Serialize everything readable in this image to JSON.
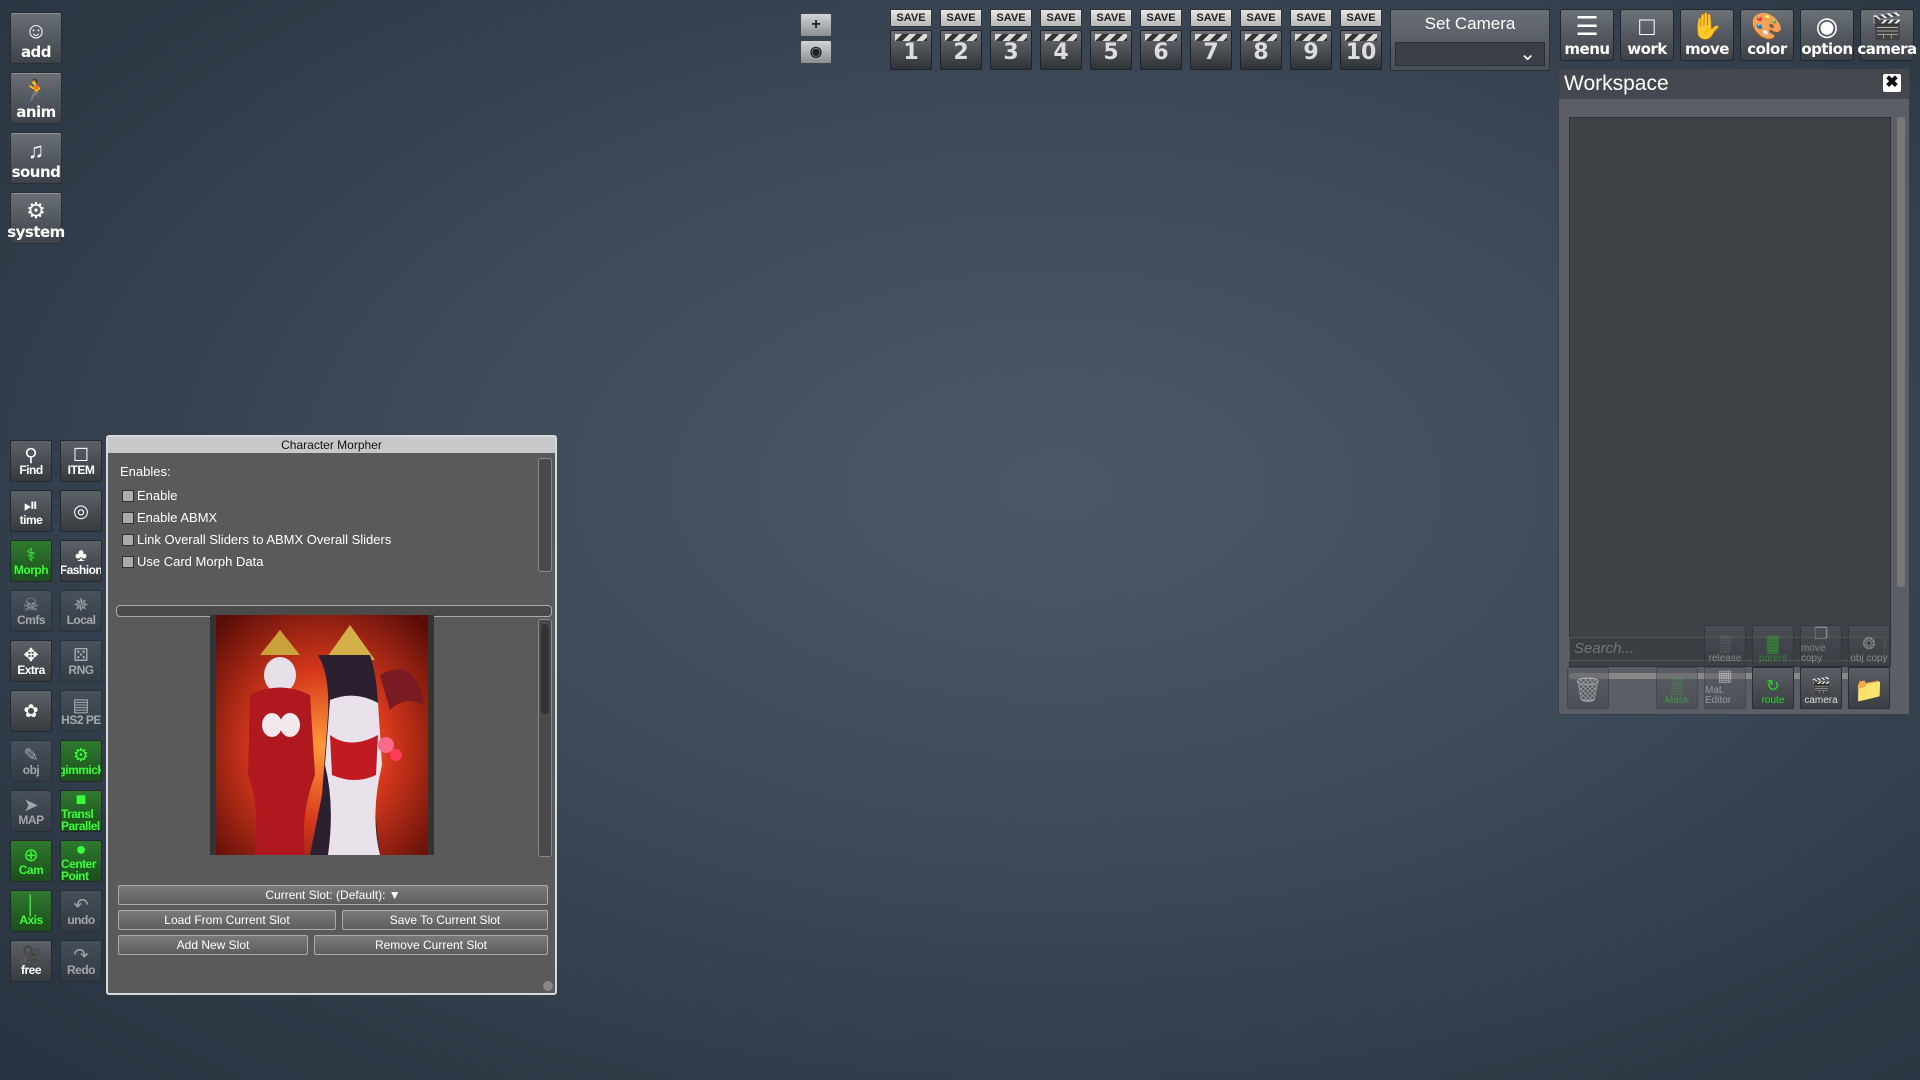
{
  "left_toolbar": {
    "buttons": [
      {
        "label": "add",
        "icon": "add-person-icon"
      },
      {
        "label": "anim",
        "icon": "running-person-icon"
      },
      {
        "label": "sound",
        "icon": "music-note-icon"
      },
      {
        "label": "system",
        "icon": "gears-icon"
      }
    ]
  },
  "tools": [
    {
      "label": "Find",
      "icon": "magnifier-icon",
      "green": false,
      "dim": false
    },
    {
      "label": "ITEM",
      "icon": "item-icon",
      "green": false,
      "dim": false
    },
    {
      "label": "time",
      "icon": "play-pause-icon",
      "green": false,
      "dim": false
    },
    {
      "label": "",
      "icon": "camera-shutter-icon",
      "green": false,
      "dim": false
    },
    {
      "label": "Morph",
      "icon": "morph-icon",
      "green": true,
      "dim": false
    },
    {
      "label": "Fashion",
      "icon": "fashion-icon",
      "green": false,
      "dim": false
    },
    {
      "label": "Cmfs",
      "icon": "skull-icon",
      "green": false,
      "dim": true
    },
    {
      "label": "Local",
      "icon": "axis-local-icon",
      "green": false,
      "dim": true
    },
    {
      "label": "Extra",
      "icon": "axis-extra-icon",
      "green": false,
      "dim": false
    },
    {
      "label": "RNG",
      "icon": "dice-icon",
      "green": false,
      "dim": true
    },
    {
      "label": "",
      "icon": "puzzle-icon",
      "green": false,
      "dim": false
    },
    {
      "label": "HS2 PE",
      "icon": "hs2pe-icon",
      "green": false,
      "dim": true
    },
    {
      "label": "obj",
      "icon": "edit-icon",
      "green": false,
      "dim": true
    },
    {
      "label": "gimmick",
      "icon": "gear-icon",
      "green": true,
      "dim": false
    },
    {
      "label": "MAP",
      "icon": "map-icon",
      "green": false,
      "dim": true
    },
    {
      "label": "Transl Parallel",
      "icon": "translate-icon",
      "green": true,
      "dim": false
    },
    {
      "label": "Cam",
      "icon": "plus-circle-icon",
      "green": true,
      "dim": false
    },
    {
      "label": "Center Point",
      "icon": "center-point-icon",
      "green": true,
      "dim": false
    },
    {
      "label": "Axis",
      "icon": "axis-icon",
      "green": true,
      "dim": false
    },
    {
      "label": "undo",
      "icon": "undo-icon",
      "green": false,
      "dim": true
    },
    {
      "label": "free",
      "icon": "film-camera-icon",
      "green": false,
      "dim": false
    },
    {
      "label": "Redo",
      "icon": "redo-icon",
      "green": false,
      "dim": true
    }
  ],
  "top": {
    "plus": "+",
    "eye_icon": "eye-icon",
    "save_label": "SAVE",
    "slots": [
      "1",
      "2",
      "3",
      "4",
      "5",
      "6",
      "7",
      "8",
      "9",
      "10"
    ],
    "set_camera": "Set Camera",
    "icons": [
      {
        "label": "menu",
        "icon": "list-icon"
      },
      {
        "label": "work",
        "icon": "frame-icon"
      },
      {
        "label": "move",
        "icon": "hand-icon"
      },
      {
        "label": "color",
        "icon": "palette-icon"
      },
      {
        "label": "option",
        "icon": "eye-icon"
      },
      {
        "label": "camera",
        "icon": "clapperboard-icon"
      }
    ]
  },
  "workspace": {
    "title": "Workspace",
    "search_placeholder": "Search...",
    "row1": [
      {
        "label": "release",
        "icon": "release-icon",
        "dim": true,
        "green": false
      },
      {
        "label": "parent",
        "icon": "parent-icon",
        "dim": true,
        "green": true
      },
      {
        "label": "move copy",
        "icon": "move-copy-icon",
        "dim": true,
        "green": false
      },
      {
        "label": "obj copy",
        "icon": "obj-copy-icon",
        "dim": true,
        "green": false
      }
    ],
    "row2": [
      {
        "label": "",
        "icon": "trash-icon",
        "dim": true,
        "green": false
      },
      {
        "label": "Mask",
        "icon": "mask-icon",
        "dim": true,
        "green": true
      },
      {
        "label": "Mat. Editor",
        "icon": "material-icon",
        "dim": true,
        "green": false
      },
      {
        "label": "route",
        "icon": "route-icon",
        "dim": false,
        "green": true
      },
      {
        "label": "camera",
        "icon": "clapperboard-icon",
        "dim": false,
        "green": false
      },
      {
        "label": "",
        "icon": "folder-icon",
        "dim": false,
        "green": false
      }
    ]
  },
  "morpher": {
    "title": "Character Morpher",
    "enables_label": "Enables:",
    "checks": [
      "Enable",
      "Enable ABMX",
      "Link Overall Sliders to ABMX Overall Sliders",
      "Use Card Morph Data"
    ],
    "current_slot": "Current Slot: (Default): ▼",
    "load": "Load From Current Slot",
    "save": "Save To Current Slot",
    "add": "Add New Slot",
    "remove": "Remove Current Slot"
  },
  "colors": {
    "accent_green": "#39ff39",
    "panel_bg": "#5a5a5a",
    "background": "#3c4958"
  }
}
